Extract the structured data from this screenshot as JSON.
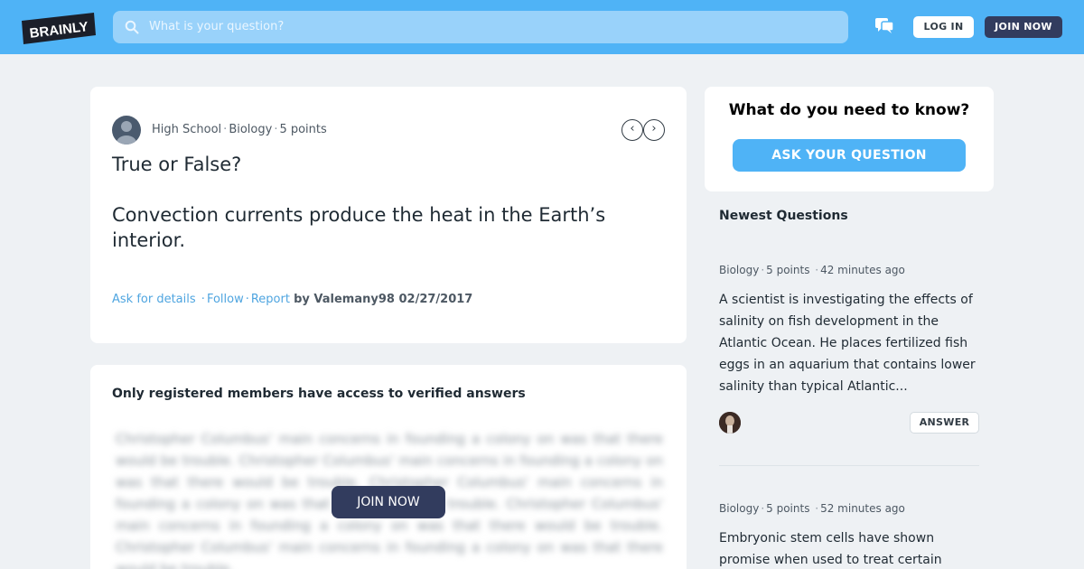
{
  "header": {
    "logo_text": "BRAINLY",
    "search_placeholder": "What is your question?",
    "login_label": "LOG IN",
    "join_label": "JOIN NOW",
    "brand_color": "#4fb3f6",
    "dark_color": "#323c5e"
  },
  "question": {
    "level": "High School",
    "subject": "Biology",
    "points": "5 points",
    "line1": "True or False?",
    "line2": "Convection currents produce the heat in the Earth’s interior.",
    "ask_details": "Ask for details",
    "follow": "Follow",
    "report": "Report",
    "byline": "by Valemany98 02/27/2017",
    "prev_icon": "chevron-left-icon",
    "next_icon": "chevron-right-icon"
  },
  "answer_block": {
    "title": "Only registered members have access to verified answers",
    "blurred_text": "Christopher Columbus' main concerns in founding a colony on was that there would be trouble. Christopher Columbus' main concerns in founding a colony on was that there would be trouble. Christopher Columbus' main concerns in founding a colony on was that there would be trouble. Christopher Columbus' main concerns in founding a colony on was that there would be trouble. Christopher Columbus' main concerns in founding a colony on was that there would be trouble.",
    "join_label": "JOIN NOW"
  },
  "ask_card": {
    "title": "What do you need to know?",
    "button_label": "ASK YOUR QUESTION"
  },
  "newest": {
    "title": "Newest Questions",
    "items": [
      {
        "subject": "Biology",
        "points": "5 points",
        "time": "42 minutes ago",
        "text": "A scientist is investigating the effects of salinity on fish development in the Atlantic Ocean. He places fertilized fish eggs in an aquarium that contains lower salinity than typical Atlantic...",
        "answer_label": "ANSWER"
      },
      {
        "subject": "Biology",
        "points": "5 points",
        "time": "52 minutes ago",
        "text": "Embryonic stem cells have shown promise when used to treat certain"
      }
    ]
  }
}
